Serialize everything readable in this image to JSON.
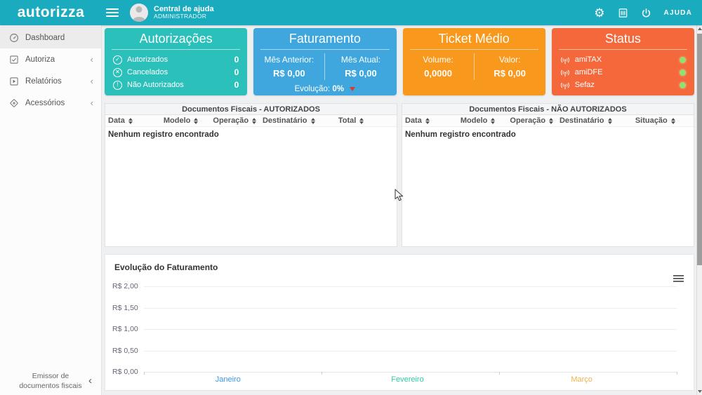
{
  "theme": {
    "header_color": "#1aacbe",
    "background_color": "#eef0f2",
    "online_dot_color": "#90e26d"
  },
  "icons": {
    "check": "✓",
    "close": "✕",
    "warn": "!",
    "chevron_left": "‹",
    "gear": "⚙"
  },
  "header": {
    "logo_text": "autorizza",
    "user": {
      "title": "Central de ajuda",
      "subtitle": "ADMINISTRADOR"
    },
    "help_label": "AJUDA"
  },
  "sidebar": {
    "items": [
      {
        "label": "Dashboard",
        "active": true
      },
      {
        "label": "Autoriza",
        "active": false
      },
      {
        "label": "Relatórios",
        "active": false
      },
      {
        "label": "Acessórios",
        "active": false
      }
    ],
    "footer_line1": "Emissor de",
    "footer_line2": "documentos fiscais"
  },
  "cards": {
    "autorizacoes": {
      "title": "Autorizações",
      "color": "#2cc0bb",
      "rows": [
        {
          "icon": "check-circle-icon",
          "label": "Autorizados",
          "value": "0"
        },
        {
          "icon": "x-circle-icon",
          "label": "Cancelados",
          "value": "0"
        },
        {
          "icon": "exclamation-circle-icon",
          "label": "Não Autorizados",
          "value": "0"
        }
      ]
    },
    "faturamento": {
      "title": "Faturamento",
      "color": "#3fa7dd",
      "left_label": "Mês Anterior:",
      "left_value": "R$ 0,00",
      "right_label": "Mês Atual:",
      "right_value": "R$ 0,00",
      "evolution_label": "Evolução:",
      "evolution_value": "0%"
    },
    "ticket_medio": {
      "title": "Ticket Médio",
      "color": "#f8981d",
      "left_label": "Volume:",
      "left_value": "0,0000",
      "right_label": "Valor:",
      "right_value": "R$ 0,00"
    },
    "status": {
      "title": "Status",
      "color": "#f4683c",
      "online_color": "#90e26d",
      "rows": [
        {
          "icon": "broadcast-icon",
          "label": "amiTAX",
          "status": "online"
        },
        {
          "icon": "broadcast-icon",
          "label": "amiDFE",
          "status": "online"
        },
        {
          "icon": "broadcast-icon",
          "label": "Sefaz",
          "status": "online"
        }
      ]
    }
  },
  "tables": {
    "authorized": {
      "title": "Documentos Fiscais - AUTORIZADOS",
      "columns": [
        "Data",
        "Modelo",
        "Operação",
        "Destinatário",
        "Total"
      ],
      "empty_message": "Nenhum registro encontrado"
    },
    "not_authorized": {
      "title": "Documentos Fiscais - NÃO AUTORIZADOS",
      "columns": [
        "Data",
        "Modelo",
        "Operação",
        "Destinatário",
        "Situação"
      ],
      "empty_message": "Nenhum registro encontrado"
    }
  },
  "chart": {
    "title": "Evolução do Faturamento"
  },
  "chart_data": {
    "type": "line",
    "title": "Evolução do Faturamento",
    "categories": [
      "Janeiro",
      "Fevereiro",
      "Março"
    ],
    "category_colors": [
      "#3e97e0",
      "#2fc8a8",
      "#efb34f"
    ],
    "yticks": [
      "R$ 2,00",
      "R$ 1,50",
      "R$ 1,00",
      "R$ 0,50",
      "R$ 0,00"
    ],
    "ylim": [
      0,
      2
    ],
    "series": [
      {
        "name": "Faturamento",
        "values": [
          0,
          0,
          0
        ]
      }
    ],
    "grid": true,
    "legend": "none"
  }
}
